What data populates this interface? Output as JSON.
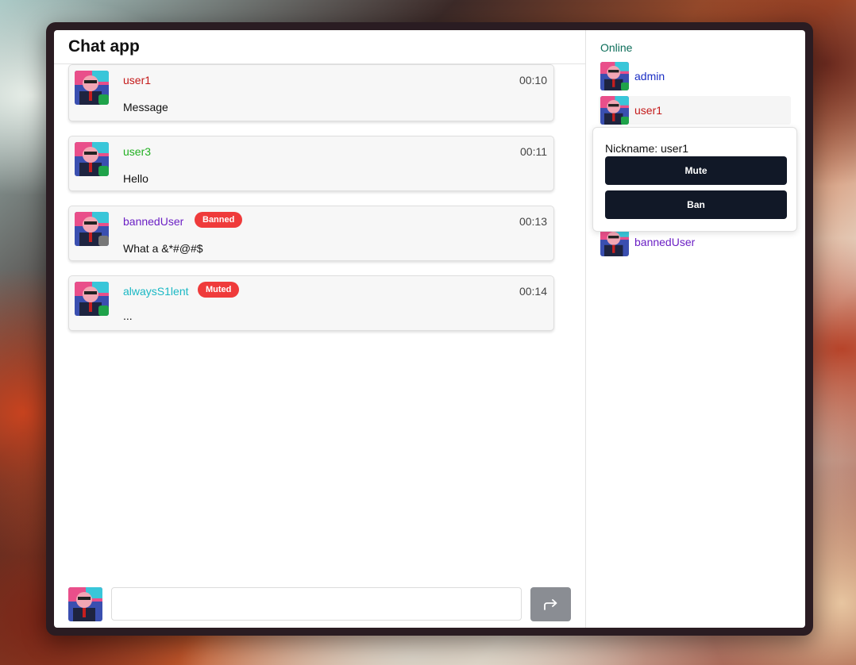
{
  "app": {
    "title": "Chat app"
  },
  "colors": {
    "user1": "#c41a1a",
    "user3": "#22b022",
    "bannedUser": "#6b1fc4",
    "alwaysS1lent": "#1ab8c4",
    "admin": "#1a2ec4",
    "online_status": "#1fa34a",
    "banned_status": "#777777",
    "badge": "#ef3b3b",
    "popover_button": "#111827",
    "send_button": "#8a8d93"
  },
  "messages": [
    {
      "author": "user1",
      "time": "00:10",
      "text": "Message",
      "badge": ""
    },
    {
      "author": "user3",
      "time": "00:11",
      "text": "Hello",
      "badge": ""
    },
    {
      "author": "bannedUser",
      "time": "00:13",
      "text": "What a &*#@#$",
      "badge": "Banned"
    },
    {
      "author": "alwaysS1lent",
      "time": "00:14",
      "text": "...",
      "badge": "Muted"
    }
  ],
  "composer": {
    "value": "",
    "send_icon": "share-arrow-icon"
  },
  "sidebar": {
    "online_label": "Online",
    "users": [
      {
        "name": "admin"
      },
      {
        "name": "user1"
      },
      {
        "name": "bannedUser"
      }
    ],
    "popover": {
      "nickname": "Nickname: user1",
      "mute_label": "Mute",
      "ban_label": "Ban"
    }
  }
}
